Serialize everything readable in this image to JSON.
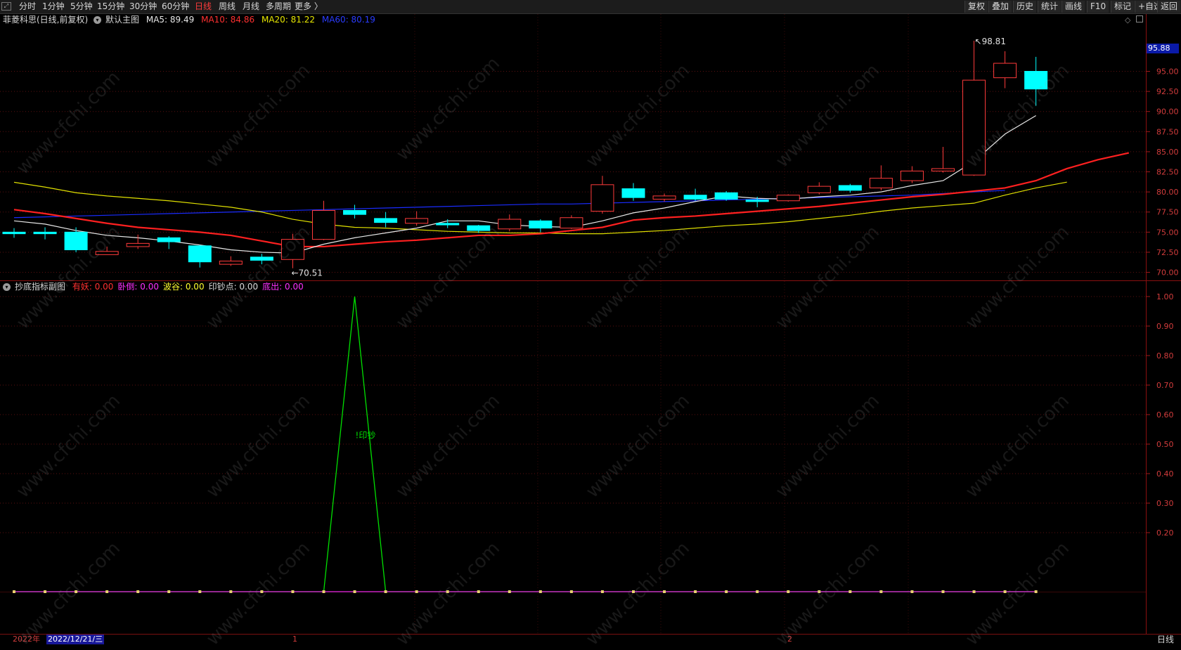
{
  "toolbar": {
    "periods": [
      "分时",
      "1分钟",
      "5分钟",
      "15分钟",
      "30分钟",
      "60分钟",
      "日线",
      "周线",
      "月线",
      "多周期",
      "更多 〉"
    ],
    "active_period": "日线",
    "right_buttons": [
      "复权",
      "叠加",
      "历史",
      "统计",
      "画线",
      "F10",
      "标记",
      "+自选",
      "返回"
    ]
  },
  "main_legend": {
    "stock": "菲菱科思(日线,前复权)",
    "template": "默认主图",
    "ma5": "MA5: 89.49",
    "ma10": "MA10: 84.86",
    "ma20": "MA20: 81.22",
    "ma60": "MA60: 80.19"
  },
  "sub_legend": {
    "name": "抄底指标副图",
    "items": [
      {
        "text": "有妖: 0.00",
        "color": "#ff3030"
      },
      {
        "text": "卧倒: 0.00",
        "color": "#ff30ff"
      },
      {
        "text": "波谷: 0.00",
        "color": "#ffff30"
      },
      {
        "text": "印钞点: 0.00",
        "color": "#dcdcdc"
      },
      {
        "text": "底出: 0.00",
        "color": "#ff30ff"
      }
    ]
  },
  "colors": {
    "up": "#ff3b3b",
    "down": "#00ffff",
    "ma5": "#e8e8e8",
    "ma10": "#ff2020",
    "ma20": "#e0e000",
    "ma60": "#1a2cff",
    "signal": "#00e000"
  },
  "price_tag": "95.88",
  "high_label": "98.81",
  "low_label": "70.51",
  "signal_label": "!印钞",
  "bottom": {
    "year": "2022年",
    "date": "2022/12/21/三",
    "month1": "1",
    "month2": "2",
    "period": "日线"
  },
  "watermark": "www.cfchi.com",
  "chart_data": [
    {
      "type": "candlestick",
      "title": "",
      "ylim": [
        69.0,
        99.5
      ],
      "yticks": [
        70.0,
        72.5,
        75.0,
        77.5,
        80.0,
        82.5,
        85.0,
        87.5,
        90.0,
        92.5,
        95.0
      ],
      "candles": [
        {
          "o": 75.0,
          "h": 75.5,
          "l": 74.3,
          "c": 74.8
        },
        {
          "o": 75.0,
          "h": 75.6,
          "l": 74.1,
          "c": 74.8
        },
        {
          "o": 75.0,
          "h": 75.6,
          "l": 72.5,
          "c": 72.8
        },
        {
          "o": 72.2,
          "h": 73.2,
          "l": 72.2,
          "c": 72.6
        },
        {
          "o": 73.2,
          "h": 74.7,
          "l": 72.9,
          "c": 73.6
        },
        {
          "o": 74.3,
          "h": 74.5,
          "l": 72.9,
          "c": 73.8
        },
        {
          "o": 73.3,
          "h": 73.4,
          "l": 70.6,
          "c": 71.3
        },
        {
          "o": 71.0,
          "h": 72.0,
          "l": 70.8,
          "c": 71.4
        },
        {
          "o": 71.9,
          "h": 72.3,
          "l": 71.0,
          "c": 71.5
        },
        {
          "o": 71.6,
          "h": 74.8,
          "l": 70.51,
          "c": 74.1
        },
        {
          "o": 74.1,
          "h": 78.9,
          "l": 74.0,
          "c": 77.7
        },
        {
          "o": 77.7,
          "h": 78.4,
          "l": 76.7,
          "c": 77.2
        },
        {
          "o": 76.7,
          "h": 77.5,
          "l": 75.6,
          "c": 76.2
        },
        {
          "o": 76.1,
          "h": 77.6,
          "l": 75.8,
          "c": 76.7
        },
        {
          "o": 76.1,
          "h": 76.6,
          "l": 75.5,
          "c": 75.9
        },
        {
          "o": 75.8,
          "h": 75.9,
          "l": 74.9,
          "c": 75.2
        },
        {
          "o": 75.4,
          "h": 77.2,
          "l": 75.1,
          "c": 76.6
        },
        {
          "o": 76.4,
          "h": 76.6,
          "l": 75.0,
          "c": 75.5
        },
        {
          "o": 75.5,
          "h": 77.1,
          "l": 75.4,
          "c": 76.8
        },
        {
          "o": 77.6,
          "h": 82.0,
          "l": 77.3,
          "c": 80.9
        },
        {
          "o": 80.4,
          "h": 81.1,
          "l": 78.9,
          "c": 79.3
        },
        {
          "o": 79.1,
          "h": 79.8,
          "l": 78.8,
          "c": 79.5
        },
        {
          "o": 79.6,
          "h": 80.4,
          "l": 78.9,
          "c": 79.1
        },
        {
          "o": 79.9,
          "h": 80.1,
          "l": 78.9,
          "c": 79.1
        },
        {
          "o": 79.0,
          "h": 79.4,
          "l": 78.1,
          "c": 78.8
        },
        {
          "o": 78.9,
          "h": 79.7,
          "l": 78.8,
          "c": 79.6
        },
        {
          "o": 79.9,
          "h": 81.2,
          "l": 79.7,
          "c": 80.7
        },
        {
          "o": 80.8,
          "h": 81.0,
          "l": 79.9,
          "c": 80.2
        },
        {
          "o": 80.5,
          "h": 83.3,
          "l": 80.2,
          "c": 81.7
        },
        {
          "o": 81.4,
          "h": 83.2,
          "l": 81.1,
          "c": 82.6
        },
        {
          "o": 82.6,
          "h": 85.6,
          "l": 82.4,
          "c": 82.9
        },
        {
          "o": 82.1,
          "h": 98.81,
          "l": 82.0,
          "c": 93.9
        },
        {
          "o": 94.2,
          "h": 97.5,
          "l": 92.9,
          "c": 96.0
        },
        {
          "o": 95.0,
          "h": 96.8,
          "l": 90.7,
          "c": 92.8
        }
      ],
      "ma5": [
        76.4,
        76.0,
        75.2,
        74.6,
        74.3,
        73.9,
        73.4,
        72.8,
        72.5,
        72.4,
        73.5,
        74.3,
        74.9,
        75.5,
        76.4,
        76.4,
        75.9,
        75.7,
        75.6,
        76.4,
        77.4,
        78.0,
        78.8,
        79.5,
        79.2,
        79.1,
        79.4,
        79.6,
        80.0,
        80.8,
        81.4,
        83.8,
        87.2,
        89.49
      ],
      "ma10": [
        77.8,
        77.3,
        76.7,
        76.1,
        75.6,
        75.3,
        75.0,
        74.6,
        73.9,
        73.2,
        73.2,
        73.5,
        73.8,
        74.0,
        74.3,
        74.6,
        74.6,
        74.8,
        75.2,
        75.6,
        76.5,
        76.8,
        77.0,
        77.3,
        77.6,
        77.9,
        78.2,
        78.6,
        79.0,
        79.4,
        79.7,
        80.1,
        80.5,
        81.4,
        82.9,
        84.0,
        84.86
      ],
      "ma20": [
        81.2,
        80.6,
        79.9,
        79.5,
        79.2,
        78.9,
        78.5,
        78.1,
        77.5,
        76.6,
        76.0,
        75.6,
        75.5,
        75.3,
        75.1,
        75.0,
        74.9,
        74.9,
        74.8,
        74.8,
        75.0,
        75.2,
        75.5,
        75.8,
        76.0,
        76.3,
        76.7,
        77.1,
        77.6,
        78.0,
        78.3,
        78.6,
        79.6,
        80.5,
        81.22
      ],
      "ma60": [
        76.8,
        76.9,
        77.0,
        77.1,
        77.2,
        77.3,
        77.4,
        77.5,
        77.6,
        77.7,
        77.8,
        77.9,
        78.0,
        78.1,
        78.2,
        78.3,
        78.4,
        78.5,
        78.5,
        78.6,
        78.7,
        78.8,
        78.9,
        79.0,
        79.1,
        79.2,
        79.3,
        79.4,
        79.5,
        79.6,
        79.8,
        80.0,
        80.19
      ]
    },
    {
      "type": "line",
      "title": "",
      "ylim": [
        0.0,
        1.0
      ],
      "yticks": [
        0.2,
        0.3,
        0.4,
        0.5,
        0.6,
        0.7,
        0.8,
        0.9,
        1.0
      ],
      "series": [
        {
          "name": "印钞点",
          "values": [
            0,
            0,
            0,
            0,
            0,
            0,
            0,
            0,
            0,
            0,
            0,
            1,
            0,
            0,
            0,
            0,
            0,
            0,
            0,
            0,
            0,
            0,
            0,
            0,
            0,
            0,
            0,
            0,
            0,
            0,
            0,
            0,
            0,
            0
          ]
        }
      ]
    }
  ]
}
